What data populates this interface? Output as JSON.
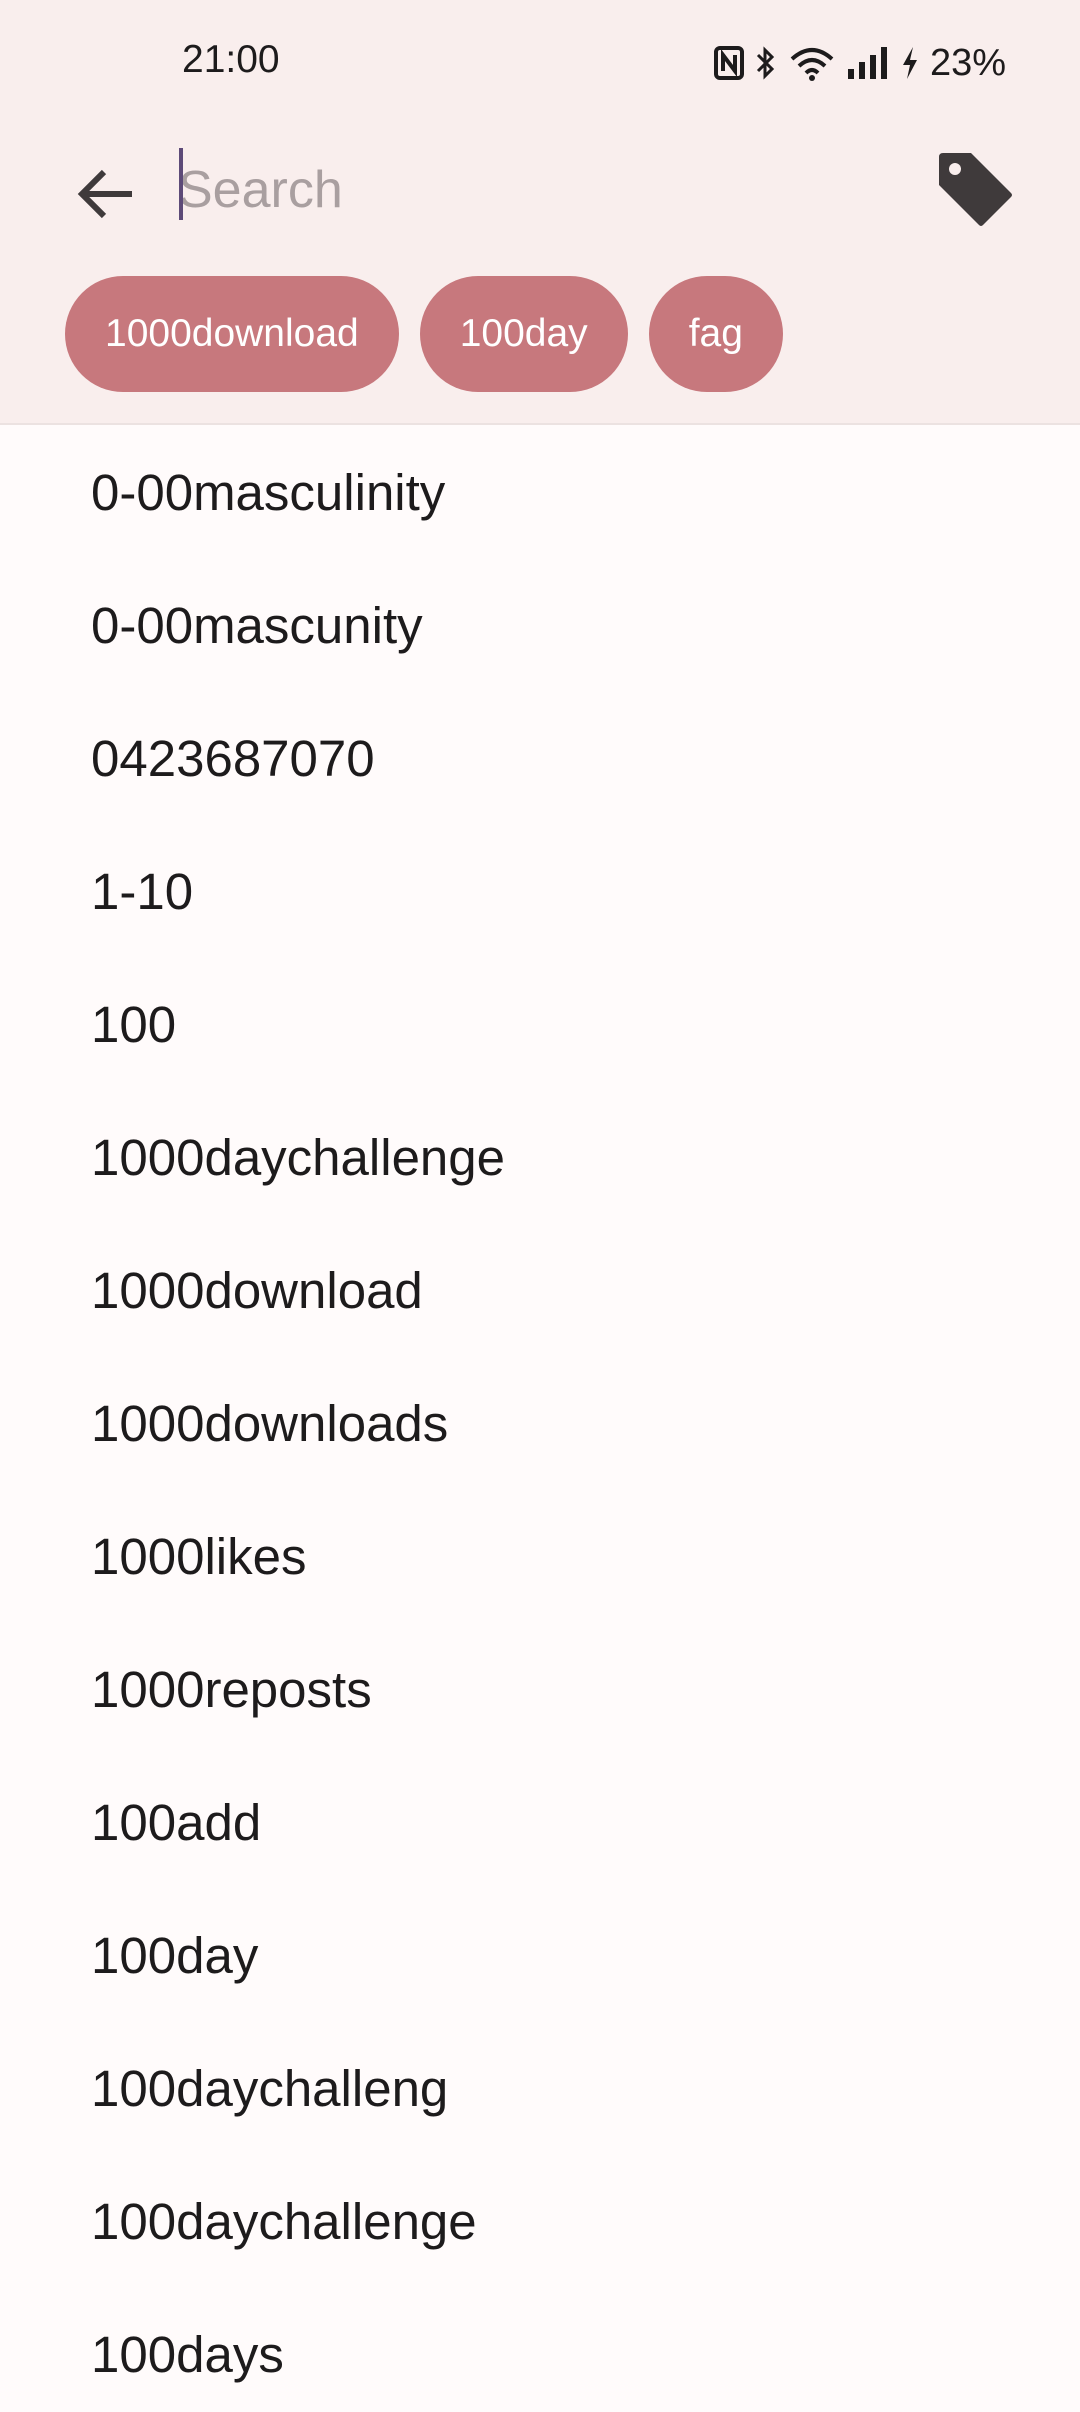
{
  "status_bar": {
    "time": "21:00",
    "battery": "23%",
    "icons": [
      "nfc-icon",
      "bluetooth-icon",
      "wifi-icon",
      "signal-icon",
      "charging-icon"
    ]
  },
  "search": {
    "placeholder": "Search",
    "value": ""
  },
  "selected_tags": [
    "1000download",
    "100day",
    "fag"
  ],
  "tag_list": [
    "0-00masculinity",
    "0-00mascunity",
    "0423687070",
    "1-10",
    "100",
    "1000daychallenge",
    "1000download",
    "1000downloads",
    "1000likes",
    "1000reposts",
    "100add",
    "100day",
    "100daychalleng",
    "100daychallenge",
    "100days"
  ],
  "colors": {
    "header_bg": "#f9eeed",
    "chip_bg": "#c7787d",
    "list_bg": "#fffbfb",
    "text": "#1d1b1c",
    "caret": "#5d4a78"
  }
}
